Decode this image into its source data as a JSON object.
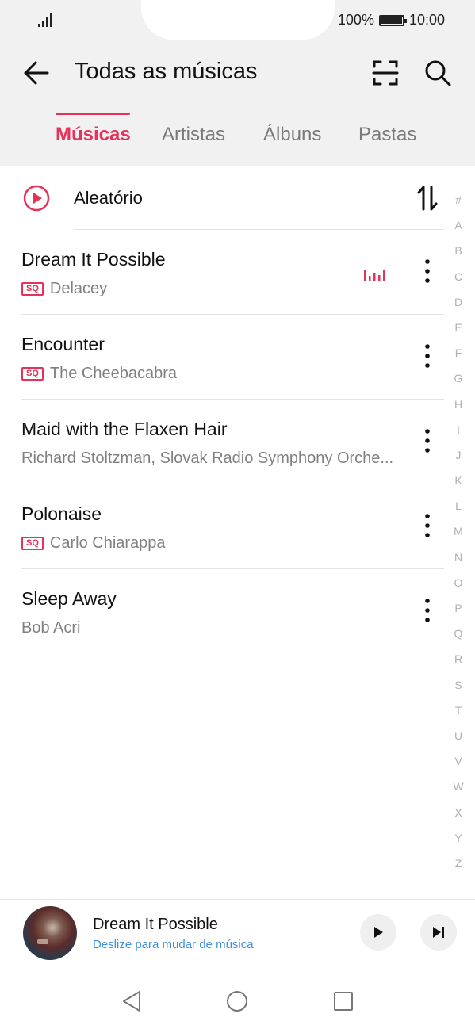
{
  "status_bar": {
    "battery": "100%",
    "time": "10:00",
    "signal_icon": "signal-icon",
    "battery_icon": "battery-icon"
  },
  "header": {
    "title": "Todas as músicas",
    "back_icon": "back-arrow-icon",
    "scan_icon": "scan-icon",
    "search_icon": "search-icon"
  },
  "tabs": [
    {
      "label": "Músicas",
      "active": true
    },
    {
      "label": "Artistas",
      "active": false
    },
    {
      "label": "Álbuns",
      "active": false
    },
    {
      "label": "Pastas",
      "active": false
    }
  ],
  "shuffle": {
    "label": "Aleatório",
    "icon": "play-circle-icon",
    "sort_icon": "sort-icon"
  },
  "songs": [
    {
      "title": "Dream It Possible",
      "artist": "Delacey",
      "sq": "SQ",
      "playing": true
    },
    {
      "title": "Encounter",
      "artist": "The Cheebacabra",
      "sq": "SQ",
      "playing": false
    },
    {
      "title": "Maid with the Flaxen Hair",
      "artist": "Richard Stoltzman, Slovak Radio Symphony Orche...",
      "sq": "",
      "playing": false
    },
    {
      "title": "Polonaise",
      "artist": "Carlo Chiarappa",
      "sq": "SQ",
      "playing": false
    },
    {
      "title": "Sleep Away",
      "artist": "Bob Acri",
      "sq": "",
      "playing": false
    }
  ],
  "alphabet": [
    "#",
    "A",
    "B",
    "C",
    "D",
    "E",
    "F",
    "G",
    "H",
    "I",
    "J",
    "K",
    "L",
    "M",
    "N",
    "O",
    "P",
    "Q",
    "R",
    "S",
    "T",
    "U",
    "V",
    "W",
    "X",
    "Y",
    "Z"
  ],
  "mini_player": {
    "title": "Dream It Possible",
    "subtitle": "Deslize para mudar de música",
    "play_icon": "play-icon",
    "next_icon": "skip-next-icon"
  },
  "colors": {
    "accent": "#e6315a",
    "link": "#3d8fe0",
    "header_bg": "#f1f1f1"
  }
}
